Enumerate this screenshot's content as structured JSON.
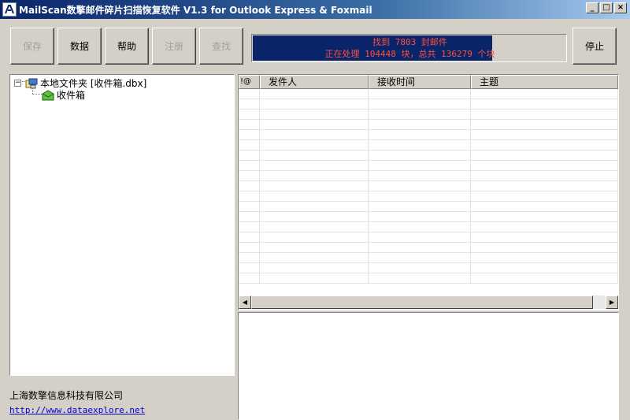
{
  "window": {
    "title": "MailScan数擎邮件碎片扫描恢复软件 V1.3  for Outlook Express & Foxmail",
    "minimize": "_",
    "maximize": "□",
    "close": "×"
  },
  "toolbar": {
    "save": "保存",
    "data": "数据",
    "help": "帮助",
    "register": "注册",
    "find": "查找",
    "stop": "停止"
  },
  "progress": {
    "line1": "找到 7803 封邮件",
    "line2": "正在处理 104448 块，总共 136279 个块",
    "fraction": 0.766
  },
  "tree": {
    "root_label": "本地文件夹 [收件箱.dbx]",
    "root_expander": "−",
    "child_label": "收件箱"
  },
  "list": {
    "columns": [
      "!@",
      "发件人",
      "接收时间",
      "主题"
    ],
    "scroll_left": "◀",
    "scroll_right": "▶"
  },
  "footer": {
    "company": "上海数擎信息科技有限公司",
    "website": "http://www.dataexplore.net"
  }
}
